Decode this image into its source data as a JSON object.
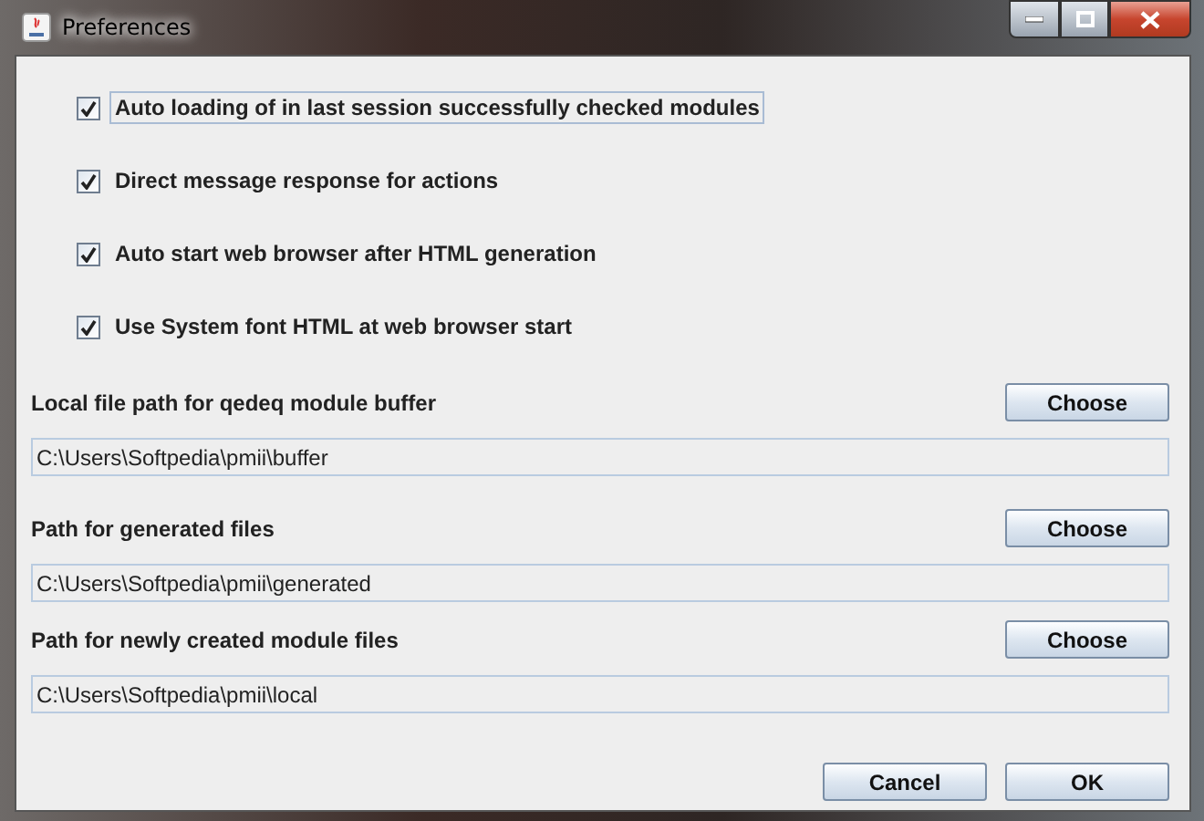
{
  "window": {
    "title": "Preferences"
  },
  "options": [
    {
      "label": "Auto loading of in last session successfully checked modules",
      "checked": true,
      "focused": true
    },
    {
      "label": "Direct message response for actions",
      "checked": true,
      "focused": false
    },
    {
      "label": "Auto start web browser after HTML generation",
      "checked": true,
      "focused": false
    },
    {
      "label": "Use System font HTML at web browser start",
      "checked": true,
      "focused": false
    }
  ],
  "paths": [
    {
      "label": "Local file path for qedeq module buffer",
      "button": "Choose",
      "value": "C:\\Users\\Softpedia\\pmii\\buffer"
    },
    {
      "label": "Path for generated files",
      "button": "Choose",
      "value": "C:\\Users\\Softpedia\\pmii\\generated"
    },
    {
      "label": "Path for newly created module files",
      "button": "Choose",
      "value": "C:\\Users\\Softpedia\\pmii\\local"
    }
  ],
  "buttons": [
    "Cancel",
    "OK"
  ]
}
